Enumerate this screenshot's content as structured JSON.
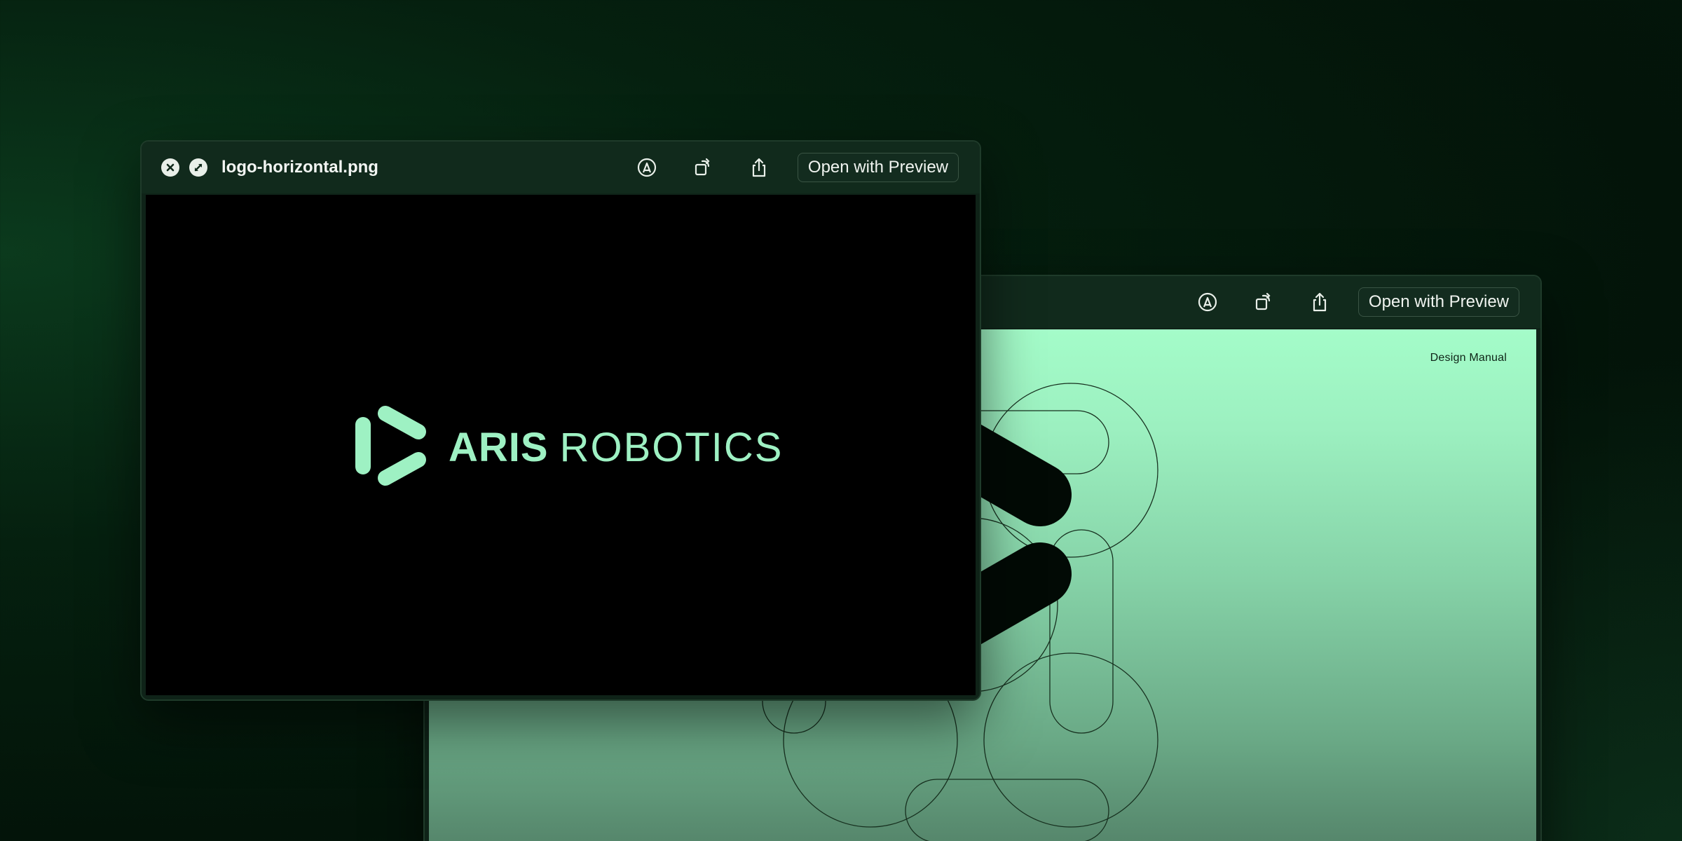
{
  "colors": {
    "accent_mint": "#9ef1c3",
    "background_dark": "#05200f",
    "logo_black": "#020a05"
  },
  "back_window": {
    "toolbar": {
      "icons": [
        "markup-icon",
        "rotate-icon",
        "share-icon"
      ],
      "open_button": "Open with Preview"
    },
    "document": {
      "header_right": "Design Manual"
    }
  },
  "front_window": {
    "title": {
      "filename": "logo-horizontal.png",
      "icons": [
        "close-icon",
        "fullscreen-icon"
      ]
    },
    "toolbar": {
      "icons": [
        "markup-icon",
        "rotate-icon",
        "share-icon"
      ],
      "open_button": "Open with Preview"
    },
    "logo": {
      "word_bold": "ARIS",
      "word_regular": "ROBOTICS"
    }
  }
}
